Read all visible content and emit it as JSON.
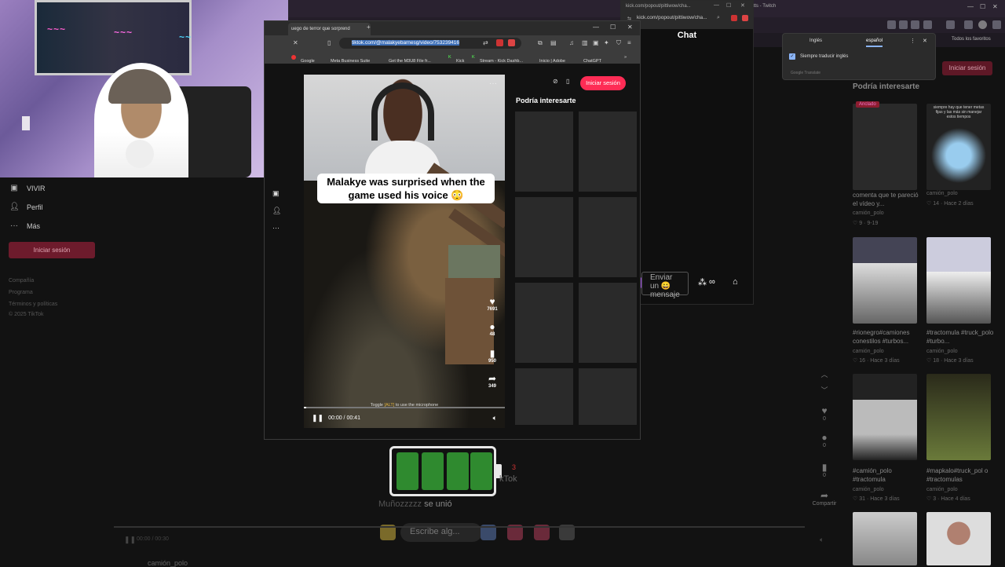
{
  "background_browser": {
    "tabs": [
      "Twitch"
    ],
    "twitch_tab_suffix": "ftts - Twitch",
    "bookmarks_right": "Todos los favoritos"
  },
  "tiktok_sidebar": {
    "items": [
      {
        "label": "VIVIR",
        "icon": "live-icon"
      },
      {
        "label": "Perfil",
        "icon": "profile-icon"
      },
      {
        "label": "Más",
        "icon": "more-icon"
      }
    ],
    "login_button": "Iniciar sesión",
    "footer": [
      "Compañía",
      "Programa",
      "Términos y políticas",
      "© 2025 TikTok"
    ]
  },
  "popup_browser": {
    "tab_title": "uego de terror que sorprend",
    "url": "tiktok.com/@malakyebarnesg/video/753239416",
    "bookmarks": [
      "Google",
      "Meta Business Suite",
      "Get the M3U8 File fr...",
      "Kick",
      "Stream - Kick Dashb...",
      "Inicio | Adobe",
      "ChatGPT"
    ],
    "login_button": "Iniciar sesión"
  },
  "video": {
    "caption": "Malakye was surprised when the game used his voice 😳",
    "likes": "7691",
    "comments": "48",
    "saves": "950",
    "shares": "349",
    "hint_prefix": "Toggle",
    "hint_key": "[ALT]",
    "hint_suffix": "to use the microphone",
    "time": "00:00 / 00:41",
    "progress_fraction": 0.01
  },
  "recommendations": {
    "title": "Podría interesarte"
  },
  "kick_chat": {
    "url": "kick.com/popout/pittiwow/cha...",
    "title": "Chat",
    "input_placeholder": "Enviar un 😀 mensaje"
  },
  "translate_popup": {
    "tab_source": "Inglés",
    "tab_target": "español",
    "option": "Siempre traducir inglés",
    "footer": "Google Translate"
  },
  "right_panel": {
    "login_button": "Iniciar sesión",
    "title": "Podría interesarte",
    "pinned_badge": "Anclado",
    "cards": [
      {
        "caption": "",
        "author": "",
        "stats": ""
      },
      {
        "caption": "",
        "author": "",
        "stats": ""
      },
      {
        "caption": "comenta que te pareció el vídeo y...",
        "author": "camión_polo",
        "stats": "♡ 9 · 9-19"
      },
      {
        "caption": "",
        "author": "camión_polo",
        "stats": "♡ 14 · Hace 2 días"
      },
      {
        "caption": "#rionegro#camiones conestilos #turbos...",
        "author": "camión_polo",
        "stats": "♡ 16 · Hace 3 días"
      },
      {
        "caption": "#tractomula #truck_polo #turbo...",
        "author": "camión_polo",
        "stats": "♡ 18 · Hace 3 días"
      },
      {
        "caption": "#camión_polo #tractomula",
        "author": "camión_polo",
        "stats": "♡ 31 · Hace 3 días"
      },
      {
        "caption": "#mapkalo#truck_pol o #tractomulas",
        "author": "camión_polo",
        "stats": "♡ 3 · Hace 4 días"
      }
    ],
    "thumb_text_1": "siempre hay que tener metas fijas y las más sin manejar estos tiempos",
    "rail_counts": [
      "0",
      "0",
      "0"
    ],
    "share_label": "Compartir"
  },
  "ghost_overlay": {
    "joined_user": "Muñozzzzz",
    "joined_text": "se unió",
    "input_placeholder": "Escribe alg...",
    "ghost_label": "kTok",
    "ghost_num": "3",
    "bottom_time": "00:00 / 00:30",
    "bottom_author": "camión_polo"
  },
  "colors": {
    "tiktok_red": "#fe2c55",
    "battery_green": "#2f8a2f"
  }
}
